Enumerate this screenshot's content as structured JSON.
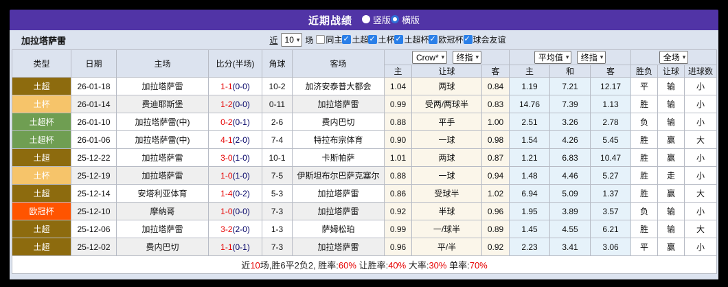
{
  "icons": {
    "chevron_down": "▾",
    "check": "✓"
  },
  "title_bar": {
    "title": "近期战绩",
    "radios": [
      {
        "label": "竖版",
        "selected": false
      },
      {
        "label": "横版",
        "selected": true
      }
    ],
    "bar_color": "#5134a6"
  },
  "filter_bar": {
    "team_name": "加拉塔萨雷",
    "prefix_label": "近",
    "count_value": "10",
    "suffix_label": "场",
    "checkboxes": [
      {
        "label": "同主",
        "checked": false
      },
      {
        "label": "土超",
        "checked": true
      },
      {
        "label": "土杯",
        "checked": true
      },
      {
        "label": "土超杯",
        "checked": true
      },
      {
        "label": "欧冠杯",
        "checked": true
      },
      {
        "label": "球会友谊",
        "checked": true
      }
    ]
  },
  "table": {
    "left_headers": [
      "类型",
      "日期",
      "主场",
      "比分(半场)",
      "角球",
      "客场"
    ],
    "handicap_group": {
      "select_a": "Crow*",
      "select_b": "终指",
      "sub_headers": [
        "主",
        "让球",
        "客"
      ]
    },
    "average_group": {
      "select_a": "平均值",
      "select_b": "终指",
      "sub_headers": [
        "主",
        "和",
        "客"
      ]
    },
    "result_group": {
      "select_a": "全场",
      "sub_headers": [
        "胜负",
        "让球",
        "进球数"
      ]
    },
    "type_colors": {
      "土超": "#8d6b0e",
      "土杯": "#f6c46a",
      "土超杯": "#6f9e52",
      "欧冠杯": "#ff5400"
    },
    "rows": [
      {
        "type": "土超",
        "date": "26-01-18",
        "home": "加拉塔萨雷",
        "home_team": true,
        "score": "1-1",
        "half": "(0-0)",
        "corner": "10-2",
        "away": "加济安泰普大都会",
        "away_team": false,
        "ah": [
          "1.04",
          "两球",
          "0.84"
        ],
        "eu": [
          "1.19",
          "7.21",
          "12.17"
        ],
        "res": [
          {
            "t": "平",
            "c": "green"
          },
          {
            "t": "输",
            "c": "blue"
          },
          {
            "t": "小",
            "c": "blue"
          }
        ],
        "shaded": false
      },
      {
        "type": "土杯",
        "date": "26-01-14",
        "home": "费迪耶斯堡",
        "home_team": false,
        "score": "1-2",
        "half": "(0-0)",
        "corner": "0-11",
        "away": "加拉塔萨雷",
        "away_team": true,
        "ah": [
          "0.99",
          "受两/两球半",
          "0.83"
        ],
        "eu": [
          "14.76",
          "7.39",
          "1.13"
        ],
        "res": [
          {
            "t": "胜",
            "c": "red"
          },
          {
            "t": "输",
            "c": "blue"
          },
          {
            "t": "小",
            "c": "blue"
          }
        ],
        "shaded": true
      },
      {
        "type": "土超杯",
        "date": "26-01-10",
        "home": "加拉塔萨雷(中)",
        "home_team": true,
        "score": "0-2",
        "half": "(0-1)",
        "corner": "2-6",
        "away": "费内巴切",
        "away_team": false,
        "ah": [
          "0.88",
          "平手",
          "1.00"
        ],
        "eu": [
          "2.51",
          "3.26",
          "2.78"
        ],
        "res": [
          {
            "t": "负",
            "c": "blue"
          },
          {
            "t": "输",
            "c": "blue"
          },
          {
            "t": "小",
            "c": "blue"
          }
        ],
        "shaded": false
      },
      {
        "type": "土超杯",
        "date": "26-01-06",
        "home": "加拉塔萨雷(中)",
        "home_team": true,
        "score": "4-1",
        "half": "(2-0)",
        "corner": "7-4",
        "away": "特拉布宗体育",
        "away_team": false,
        "ah": [
          "0.90",
          "一球",
          "0.98"
        ],
        "eu": [
          "1.54",
          "4.26",
          "5.45"
        ],
        "res": [
          {
            "t": "胜",
            "c": "red"
          },
          {
            "t": "赢",
            "c": "red"
          },
          {
            "t": "大",
            "c": "red"
          }
        ],
        "shaded": false
      },
      {
        "type": "土超",
        "date": "25-12-22",
        "home": "加拉塔萨雷",
        "home_team": true,
        "score": "3-0",
        "half": "(1-0)",
        "corner": "10-1",
        "away": "卡斯帕萨",
        "away_team": false,
        "ah": [
          "1.01",
          "两球",
          "0.87"
        ],
        "eu": [
          "1.21",
          "6.83",
          "10.47"
        ],
        "res": [
          {
            "t": "胜",
            "c": "red"
          },
          {
            "t": "赢",
            "c": "red"
          },
          {
            "t": "小",
            "c": "blue"
          }
        ],
        "shaded": false
      },
      {
        "type": "土杯",
        "date": "25-12-19",
        "home": "加拉塔萨雷",
        "home_team": true,
        "score": "1-0",
        "half": "(1-0)",
        "corner": "7-5",
        "away": "伊斯坦布尔巴萨克塞尔",
        "away_team": false,
        "ah": [
          "0.88",
          "一球",
          "0.94"
        ],
        "eu": [
          "1.48",
          "4.46",
          "5.27"
        ],
        "res": [
          {
            "t": "胜",
            "c": "red"
          },
          {
            "t": "走",
            "c": "green"
          },
          {
            "t": "小",
            "c": "blue"
          }
        ],
        "shaded": true
      },
      {
        "type": "土超",
        "date": "25-12-14",
        "home": "安塔利亚体育",
        "home_team": false,
        "score": "1-4",
        "half": "(0-2)",
        "corner": "5-3",
        "away": "加拉塔萨雷",
        "away_team": true,
        "ah": [
          "0.86",
          "受球半",
          "1.02"
        ],
        "eu": [
          "6.94",
          "5.09",
          "1.37"
        ],
        "res": [
          {
            "t": "胜",
            "c": "red"
          },
          {
            "t": "赢",
            "c": "red"
          },
          {
            "t": "大",
            "c": "red"
          }
        ],
        "shaded": false
      },
      {
        "type": "欧冠杯",
        "date": "25-12-10",
        "home": "摩纳哥",
        "home_team": false,
        "score": "1-0",
        "half": "(0-0)",
        "corner": "7-3",
        "away": "加拉塔萨雷",
        "away_team": true,
        "ah": [
          "0.92",
          "半球",
          "0.96"
        ],
        "eu": [
          "1.95",
          "3.89",
          "3.57"
        ],
        "res": [
          {
            "t": "负",
            "c": "blue"
          },
          {
            "t": "输",
            "c": "blue"
          },
          {
            "t": "小",
            "c": "blue"
          }
        ],
        "shaded": true
      },
      {
        "type": "土超",
        "date": "25-12-06",
        "home": "加拉塔萨雷",
        "home_team": true,
        "score": "3-2",
        "half": "(2-0)",
        "corner": "1-3",
        "away": "萨姆松珀",
        "away_team": false,
        "ah": [
          "0.99",
          "一/球半",
          "0.89"
        ],
        "eu": [
          "1.45",
          "4.55",
          "6.21"
        ],
        "res": [
          {
            "t": "胜",
            "c": "red"
          },
          {
            "t": "输",
            "c": "blue"
          },
          {
            "t": "大",
            "c": "red"
          }
        ],
        "shaded": false
      },
      {
        "type": "土超",
        "date": "25-12-02",
        "home": "费内巴切",
        "home_team": false,
        "score": "1-1",
        "half": "(0-1)",
        "corner": "7-3",
        "away": "加拉塔萨雷",
        "away_team": true,
        "ah": [
          "0.96",
          "平/半",
          "0.92"
        ],
        "eu": [
          "2.23",
          "3.41",
          "3.06"
        ],
        "res": [
          {
            "t": "平",
            "c": "green"
          },
          {
            "t": "赢",
            "c": "red"
          },
          {
            "t": "小",
            "c": "blue"
          }
        ],
        "shaded": true
      }
    ]
  },
  "footer": {
    "segments": [
      {
        "text": "近",
        "red": false
      },
      {
        "text": "10",
        "red": true
      },
      {
        "text": "场,胜6平2负2, 胜率:",
        "red": false
      },
      {
        "text": "60%",
        "red": true
      },
      {
        "text": " 让胜率:",
        "red": false
      },
      {
        "text": "40%",
        "red": true
      },
      {
        "text": " 大率:",
        "red": false
      },
      {
        "text": "30%",
        "red": true
      },
      {
        "text": " 单率:",
        "red": false
      },
      {
        "text": "70%",
        "red": true
      }
    ]
  }
}
